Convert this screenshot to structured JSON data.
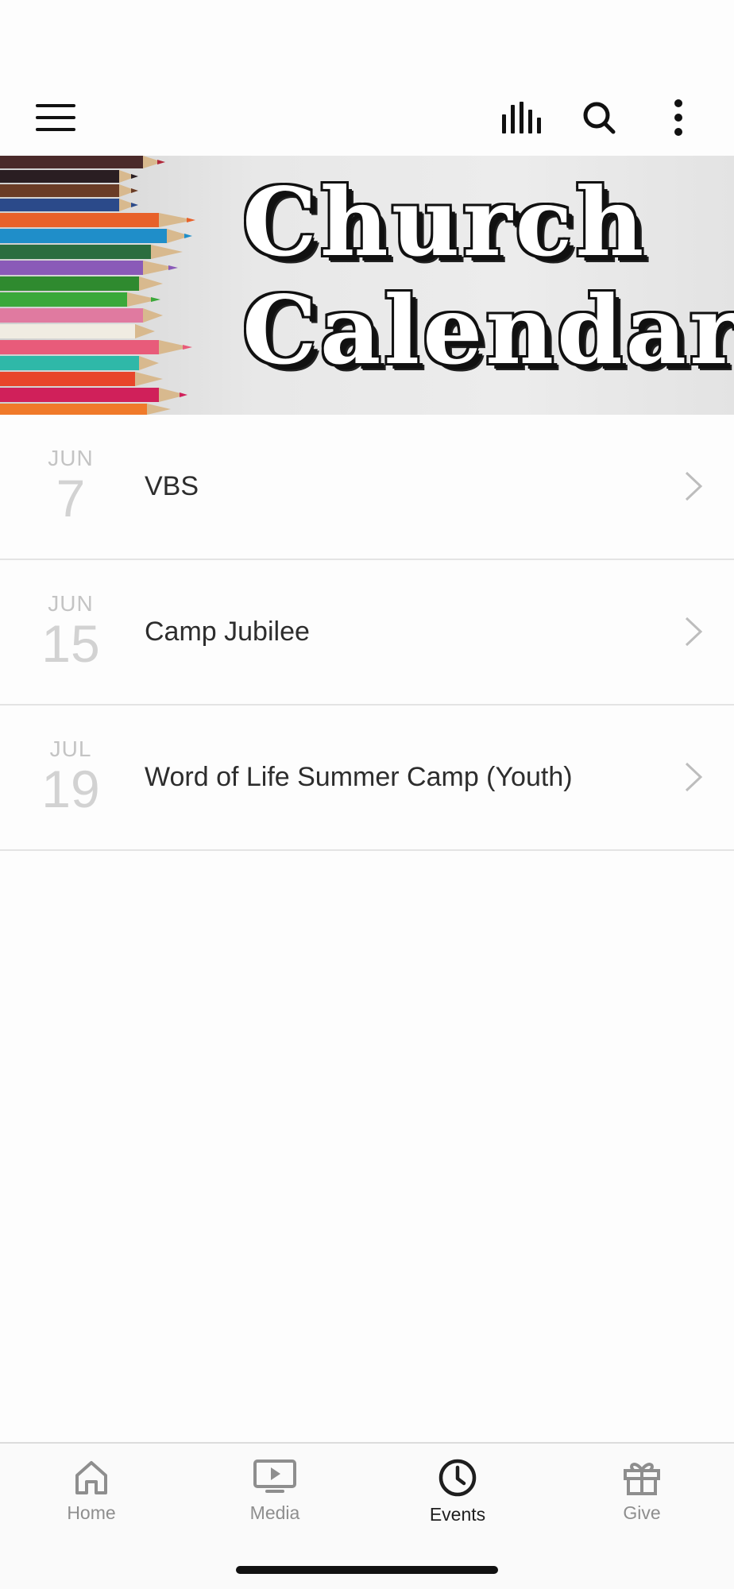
{
  "toolbar": {
    "menu_icon": "hamburger-menu-icon",
    "bars_icon": "audio-bars-icon",
    "search_icon": "search-icon",
    "more_icon": "more-vertical-icon"
  },
  "banner": {
    "line1": "Church",
    "line2": "Calendar"
  },
  "events": [
    {
      "month": "JUN",
      "day": "7",
      "title": "VBS"
    },
    {
      "month": "JUN",
      "day": "15",
      "title": "Camp Jubilee"
    },
    {
      "month": "JUL",
      "day": "19",
      "title": "Word of Life Summer Camp (Youth)"
    }
  ],
  "tabs": [
    {
      "label": "Home",
      "icon": "home-icon"
    },
    {
      "label": "Media",
      "icon": "media-play-icon"
    },
    {
      "label": "Events",
      "icon": "clock-icon",
      "active": true
    },
    {
      "label": "Give",
      "icon": "gift-icon"
    }
  ],
  "colors": {
    "active_tab": "#1e1e1e",
    "inactive_tab": "#8e8e8e",
    "date_gray": "#c4c4c4"
  }
}
